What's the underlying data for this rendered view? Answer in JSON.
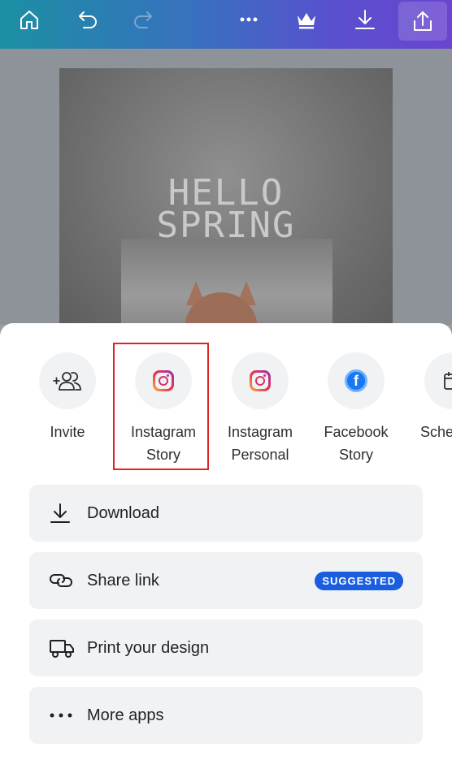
{
  "toolbar": {
    "icons": [
      "home-icon",
      "undo-icon",
      "redo-icon",
      "more-icon",
      "crown-icon",
      "download-icon",
      "share-icon"
    ]
  },
  "design": {
    "text_line1": "HELLO",
    "text_line2": "SPRING"
  },
  "share_targets": [
    {
      "label_line1": "Invite",
      "label_line2": "",
      "icon": "invite-people-icon"
    },
    {
      "label_line1": "Instagram",
      "label_line2": "Story",
      "icon": "instagram-icon",
      "highlighted": true
    },
    {
      "label_line1": "Instagram",
      "label_line2": "Personal",
      "icon": "instagram-icon"
    },
    {
      "label_line1": "Facebook",
      "label_line2": "Story",
      "icon": "facebook-icon"
    },
    {
      "label_line1": "Sche",
      "label_line2": "",
      "icon": "calendar-icon"
    }
  ],
  "actions": [
    {
      "label": "Download",
      "icon": "download-icon"
    },
    {
      "label": "Share link",
      "icon": "link-icon",
      "badge": "SUGGESTED"
    },
    {
      "label": "Print your design",
      "icon": "truck-icon"
    },
    {
      "label": "More apps",
      "icon": "more-horizontal-icon"
    }
  ],
  "colors": {
    "highlight_border": "#e02424",
    "badge_bg": "#1a5ee0",
    "action_bg": "#f1f2f4"
  }
}
